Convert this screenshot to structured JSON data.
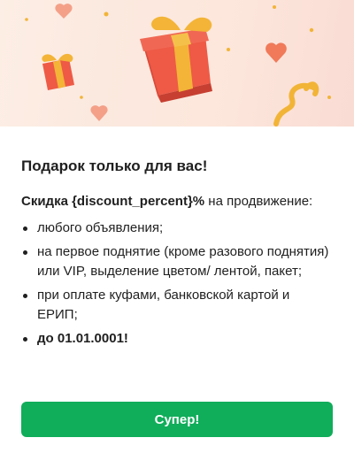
{
  "dialog": {
    "title": "Подарок только для вас!",
    "lead_bold": "Скидка {discount_percent}%",
    "lead_rest": " на продвижение:",
    "conditions": [
      "любого объявления;",
      "на первое поднятие (кроме разового поднятия) или VIP, выделение цветом/ лентой, пакет;",
      "при оплате куфами, банковской картой и ЕРИП;",
      "до 01.01.0001!"
    ],
    "confirm_label": "Супер!"
  },
  "colors": {
    "accent": "#10ad5a",
    "gift_box": "#ef5a4a",
    "ribbon": "#f3b437"
  },
  "banner": {
    "icons": [
      "gift-icon",
      "gift-icon",
      "heart-icon",
      "heart-icon",
      "ribbon-icon",
      "confetti-icon"
    ]
  }
}
